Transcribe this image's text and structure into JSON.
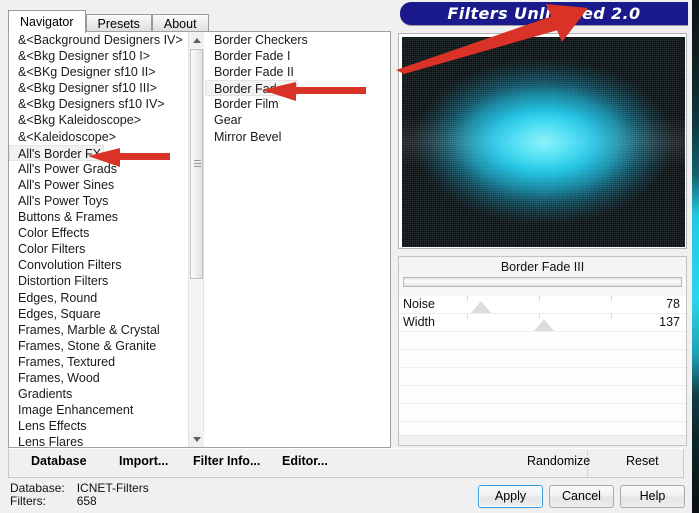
{
  "window": {
    "banner_title": "Filters Unlimited 2.0",
    "banner_color": "#1a1a8c"
  },
  "tabs": [
    {
      "label": "Navigator",
      "active": true
    },
    {
      "label": "Presets",
      "active": false
    },
    {
      "label": "About",
      "active": false
    }
  ],
  "categories": {
    "selected": "All's Border FX",
    "items": [
      "&<Background Designers IV>",
      "&<Bkg Designer sf10 I>",
      "&<BKg Designer sf10 II>",
      "&<Bkg Designer sf10 III>",
      "&<Bkg Designers sf10 IV>",
      "&<Bkg Kaleidoscope>",
      "&<Kaleidoscope>",
      "All's Border FX",
      "All's Power Grads",
      "All's Power Sines",
      "All's Power Toys",
      "Buttons & Frames",
      "Color Effects",
      "Color Filters",
      "Convolution Filters",
      "Distortion Filters",
      "Edges, Round",
      "Edges, Square",
      "Frames, Marble & Crystal",
      "Frames, Stone & Granite",
      "Frames, Textured",
      "Frames, Wood",
      "Gradients",
      "Image Enhancement",
      "Lens Effects",
      "Lens Flares"
    ]
  },
  "filters": {
    "selected": "Border Fade III",
    "items": [
      "Border Checkers",
      "Border Fade I",
      "Border Fade II",
      "Border Fade III",
      "Border Film",
      "Gear",
      "Mirror Bevel"
    ]
  },
  "preview": {
    "alt": "filter-preview-thumbnail"
  },
  "parameters": {
    "title": "Border Fade III",
    "rows": [
      {
        "label": "Noise",
        "value": "78",
        "thumb_pct": 29
      },
      {
        "label": "Width",
        "value": "137",
        "thumb_pct": 51
      },
      {
        "label": "",
        "value": "",
        "thumb_pct": null
      },
      {
        "label": "",
        "value": "",
        "thumb_pct": null
      },
      {
        "label": "",
        "value": "",
        "thumb_pct": null
      },
      {
        "label": "",
        "value": "",
        "thumb_pct": null
      },
      {
        "label": "",
        "value": "",
        "thumb_pct": null
      },
      {
        "label": "",
        "value": "",
        "thumb_pct": null
      }
    ]
  },
  "toolbar": {
    "database": "Database",
    "import": "Import...",
    "filter_info": "Filter Info...",
    "editor": "Editor...",
    "randomize": "Randomize",
    "reset": "Reset"
  },
  "status": {
    "database_key": "Database:",
    "database_value": "ICNET-Filters",
    "filters_key": "Filters:",
    "filters_value": "658"
  },
  "actions": {
    "apply": "Apply",
    "cancel": "Cancel",
    "help": "Help"
  },
  "annotations": {
    "arrow_color": "#d93226",
    "arrows": [
      {
        "name": "arrow-to-banner",
        "target": "Filters Unlimited 2.0 banner"
      },
      {
        "name": "arrow-to-border-fade-iii",
        "target": "Border Fade III"
      },
      {
        "name": "arrow-to-alls-border-fx",
        "target": "All's Border FX"
      }
    ]
  }
}
